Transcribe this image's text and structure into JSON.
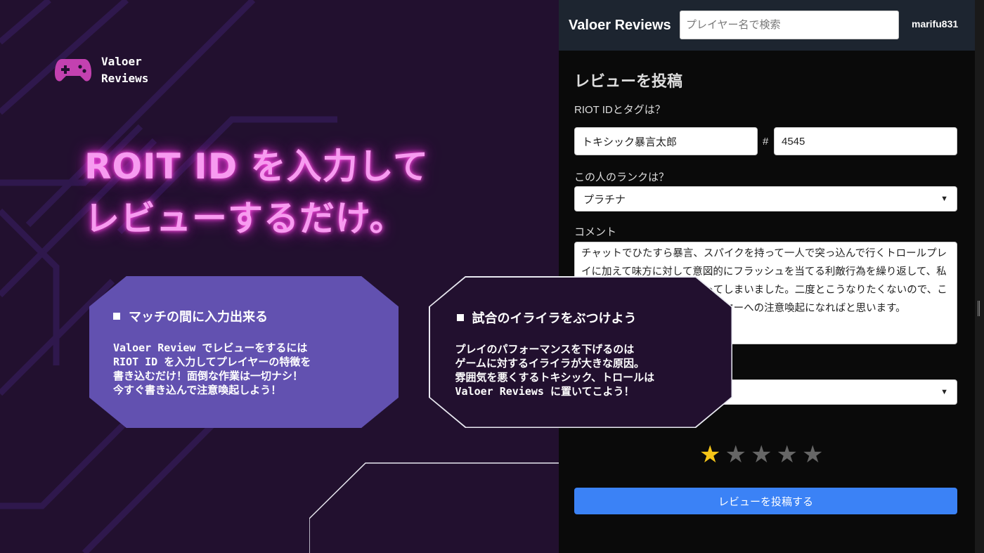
{
  "landing": {
    "logo_text": "Valoer\nReviews",
    "hero_line1": "ROIT ID を入力して",
    "hero_line2": "レビューするだけ。",
    "card1": {
      "title": "マッチの間に入力出来る",
      "body": "Valoer Review でレビューをするには\nRIOT ID を入力してプレイヤーの特徴を\n書き込むだけ！面倒な作業は一切ナシ！\n今すぐ書き込んで注意喚起しよう！"
    },
    "card2": {
      "title": "試合のイライラをぶつけよう",
      "body": "プレイのパフォーマンスを下げるのは\nゲームに対するイライラが大きな原因。\n雰囲気を悪くするトキシック、トロールは\nValoer Reviews に置いてこよう！"
    },
    "colors": {
      "background": "#22102f",
      "accent_pink": "#f79bf0",
      "card_purple": "#6251b0"
    }
  },
  "app": {
    "brand": "Valoer Reviews",
    "search_placeholder": "プレイヤー名で検索",
    "username": "marifu831",
    "form": {
      "title": "レビューを投稿",
      "riot_label": "RIOT IDとタグは？",
      "riot_name_value": "トキシック暴言太郎",
      "hash": "#",
      "riot_tag_value": "4545",
      "rank_label": "この人のランクは？",
      "rank_value": "プラチナ",
      "comment_label": "コメント",
      "comment_value": "チャットでひたすら暴言、スパイクを持って一人で突っ込んで行くトロールプレイに加えて味方に対して意図的にフラッシュを当てる利敵行為を繰り返して、私のランクはゴールまで下がってしまいました。二度とこうなりたくないので、ここに投稿することで他のプレイヤーへの注意喚起になればと思います。",
      "rating_value": 1,
      "rating_max": 5,
      "submit_label": "レビューを投稿する"
    },
    "colors": {
      "nav": "#1d2530",
      "submit": "#3b82f6",
      "star_on": "#f5c518"
    }
  }
}
